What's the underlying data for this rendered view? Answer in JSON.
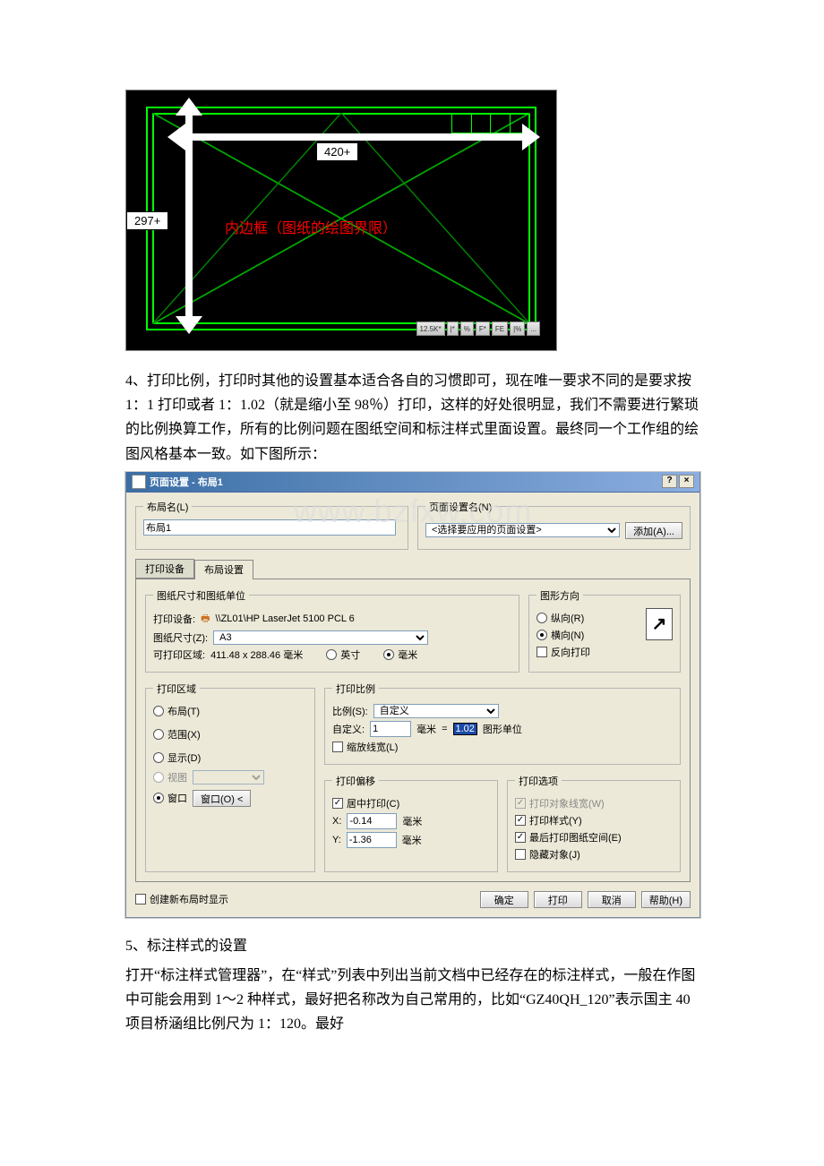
{
  "cad": {
    "dim_horizontal": "420+",
    "dim_vertical": "297+",
    "inner_text": "内边框（图纸的绘图界限）",
    "bottom_tabs": [
      "12.5K*",
      "|*",
      "%",
      "F*",
      "FE",
      "|%",
      "..."
    ]
  },
  "para4": "4、打印比例，打印时其他的设置基本适合各自的习惯即可，现在唯一要求不同的是要求按 1：1 打印或者 1：1.02（就是缩小至 98％）打印，这样的好处很明显，我们不需要进行繁琐的比例换算工作，所有的比例问题在图纸空间和标注样式里面设置。最终同一个工作组的绘图风格基本一致。如下图所示：",
  "dlg": {
    "title": "页面设置 - 布局1",
    "layout_group": "布局名(L)",
    "layout_name": "布局1",
    "page_setup_group": "页面设置名(N)",
    "page_setup_placeholder": "<选择要应用的页面设置>",
    "add_btn": "添加(A)...",
    "tab_device": "打印设备",
    "tab_layout": "布局设置",
    "paper_group": "图纸尺寸和图纸单位",
    "device_label": "打印设备:",
    "device_value": "\\\\ZL01\\HP LaserJet 5100 PCL 6",
    "size_label": "图纸尺寸(Z):",
    "size_value": "A3",
    "area_label": "可打印区域:",
    "area_value": "411.48 x 288.46 毫米",
    "unit_in": "英寸",
    "unit_mm": "毫米",
    "orient_group": "图形方向",
    "orient_portrait": "纵向(R)",
    "orient_landscape": "横向(N)",
    "orient_reverse": "反向打印",
    "print_area_group": "打印区域",
    "pa_layout": "布局(T)",
    "pa_range": "范围(X)",
    "pa_display": "显示(D)",
    "pa_view": "视图",
    "pa_window": "窗口",
    "window_btn": "窗口(O) <",
    "scale_group": "打印比例",
    "scale_label": "比例(S):",
    "scale_value": "自定义",
    "custom_label": "自定义:",
    "custom_left": "1",
    "custom_left_unit": "毫米",
    "custom_equals": "=",
    "custom_right": "1.02",
    "custom_right_unit": "图形单位",
    "scale_lw": "缩放线宽(L)",
    "offset_group": "打印偏移",
    "offset_center": "居中打印(C)",
    "offset_x_label": "X:",
    "offset_x": "-0.14",
    "offset_x_unit": "毫米",
    "offset_y_label": "Y:",
    "offset_y": "-1.36",
    "offset_y_unit": "毫米",
    "options_group": "打印选项",
    "opt_lw": "打印对象线宽(W)",
    "opt_style": "打印样式(Y)",
    "opt_last": "最后打印图纸空间(E)",
    "opt_hide": "隐藏对象(J)",
    "show_on_new": "创建新布局时显示",
    "btn_ok": "确定",
    "btn_print": "打印",
    "btn_cancel": "取消",
    "btn_help": "帮助(H)",
    "watermark": "www.bzfxw.com"
  },
  "para5_heading": "5、标注样式的设置",
  "para5": "打开“标注样式管理器”，在“样式”列表中列出当前文档中已经存在的标注样式，一般在作图中可能会用到 1～2 种样式，最好把名称改为自己常用的，比如“GZ40QH_120”表示国主 40 项目桥涵组比例尺为 1：120。最好"
}
